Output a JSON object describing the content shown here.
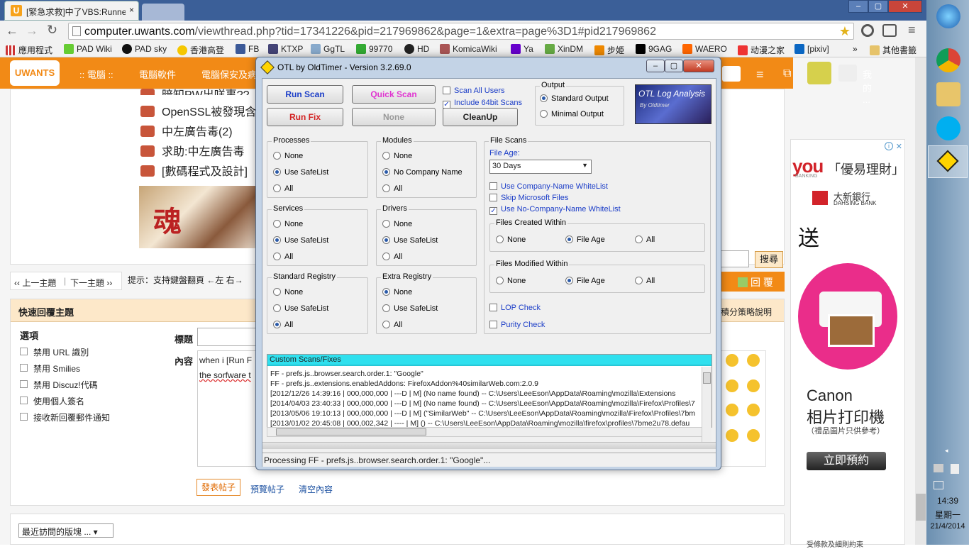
{
  "browser": {
    "tab_title": "[緊急求救]中了VBS:Runner",
    "tab_close": "×",
    "url_host": "computer.uwants.com",
    "url_path": "/viewthread.php?tid=17341226&pid=217969862&page=1&extra=page%3D1#pid217969862",
    "bookmarks": [
      "應用程式",
      "PAD Wiki",
      "PAD sky",
      "香港高登",
      "FB",
      "KTXP",
      "GgTL",
      "99770",
      "HD",
      "KomicaWiki",
      "Ya",
      "XinDM",
      "步姫",
      "9GAG",
      "WAERO",
      "动漫之家",
      "[pixiv]",
      "»",
      "其他書籤"
    ]
  },
  "site": {
    "logo": "UWANTS",
    "crumbs": [
      ":: 電腦 ::",
      "電腦軟件",
      "電腦保安及病"
    ],
    "my_link": "我的 ...",
    "threads": [
      "暗知PW出咩事??",
      "OpenSSL被發現含",
      "中左廣告毒(2)",
      "求助:中左廣告毒",
      "[數碼程式及設計]"
    ],
    "banner_text": "魂",
    "search_button": "搜尋",
    "prev_thread": "‹‹ 上一主題",
    "next_thread": "下一主題 ››",
    "hint": "提示：支持鍵盤翻頁 ←左 右→",
    "reply_button": "回 覆",
    "quick_reply_title": "快速回覆主題",
    "rules_link": "積分策略說明",
    "options_title": "選項",
    "options": [
      "禁用 URL 識別",
      "禁用 Smilies",
      "禁用 Discuz!代碼",
      "使用個人簽名",
      "接收新回覆郵件通知"
    ],
    "subject_label": "標題",
    "content_label": "內容",
    "content_text_1": "when i [Run F",
    "content_text_2": "the sorfware t",
    "post_button": "發表帖子",
    "preview_button": "預覽帖子",
    "clear_button": "清空內容",
    "recent_forums": "最近訪問的版塊 ..."
  },
  "ad": {
    "brand": "you",
    "brand_sub": "BANKING",
    "slogan": "「優易理財」",
    "bank_name": "大新銀行",
    "bank_en": "DAHSING BANK",
    "give": "送",
    "canon": "Canon",
    "product": "相片打印機",
    "note": "（禮品圖片只供參考）",
    "cta": "立即預約",
    "bottom": "受條款及細則約束"
  },
  "taskbar": {
    "time": "14:39",
    "weekday": "星期一",
    "date": "21/4/2014"
  },
  "otl": {
    "title": "OTL by OldTimer - Version 3.2.69.0",
    "buttons": {
      "run_scan": "Run Scan",
      "quick_scan": "Quick Scan",
      "run_fix": "Run Fix",
      "none": "None",
      "cleanup": "CleanUp"
    },
    "scan_all_users": "Scan All Users",
    "include_64bit": "Include 64bit Scans",
    "output": {
      "legend": "Output",
      "standard": "Standard Output",
      "minimal": "Minimal Output"
    },
    "logo_text": "OTL Log Analysis",
    "logo_sub": "By Oldtimer",
    "groups": {
      "processes": {
        "legend": "Processes",
        "opts": [
          "None",
          "Use SafeList",
          "All"
        ],
        "selected": 1
      },
      "modules": {
        "legend": "Modules",
        "opts": [
          "None",
          "No Company Name",
          "All"
        ],
        "selected": 1
      },
      "services": {
        "legend": "Services",
        "opts": [
          "None",
          "Use SafeList",
          "All"
        ],
        "selected": 1
      },
      "drivers": {
        "legend": "Drivers",
        "opts": [
          "None",
          "Use SafeList",
          "All"
        ],
        "selected": 1
      },
      "std_registry": {
        "legend": "Standard Registry",
        "opts": [
          "None",
          "Use SafeList",
          "All"
        ],
        "selected": 2
      },
      "extra_registry": {
        "legend": "Extra Registry",
        "opts": [
          "None",
          "Use SafeList",
          "All"
        ],
        "selected": 0
      }
    },
    "file_scans": {
      "legend": "File Scans",
      "file_age_label": "File Age:",
      "file_age_value": "30 Days",
      "use_company_whitelist": "Use Company-Name WhiteList",
      "skip_microsoft": "Skip Microsoft Files",
      "use_no_company_whitelist": "Use No-Company-Name WhiteList",
      "created_legend": "Files Created Within",
      "modified_legend": "Files Modified Within",
      "within_opts": [
        "None",
        "File Age",
        "All"
      ],
      "lop_check": "LOP Check",
      "purity_check": "Purity Check"
    },
    "custom_header": "Custom Scans/Fixes",
    "log_lines": [
      "FF - prefs.js..browser.search.order.1: \"Google\"",
      "FF - prefs.js..extensions.enabledAddons: FirefoxAddon%40similarWeb.com:2.0.9",
      "[2012/12/26 14:39:16 | 000,000,000 | ---D | M] (No name found) -- C:\\Users\\LeeEson\\AppData\\Roaming\\mozilla\\Extensions",
      "[2014/04/03 23:40:33 | 000,000,000 | ---D | M] (No name found) -- C:\\Users\\LeeEson\\AppData\\Roaming\\mozilla\\Firefox\\Profiles\\7",
      "[2013/05/06 19:10:13 | 000,000,000 | ---D | M] (\"SimilarWeb\" -- C:\\Users\\LeeEson\\AppData\\Roaming\\mozilla\\Firefox\\Profiles\\7bm",
      "[2013/01/02 20:45:08 | 000,002,342 | ---- | M] () -- C:\\Users\\LeeEson\\AppData\\Roaming\\mozilla\\firefox\\profiles\\7bme2u78.defau"
    ],
    "status": "Processing FF - prefs.js..browser.search.order.1: \"Google\"..."
  }
}
